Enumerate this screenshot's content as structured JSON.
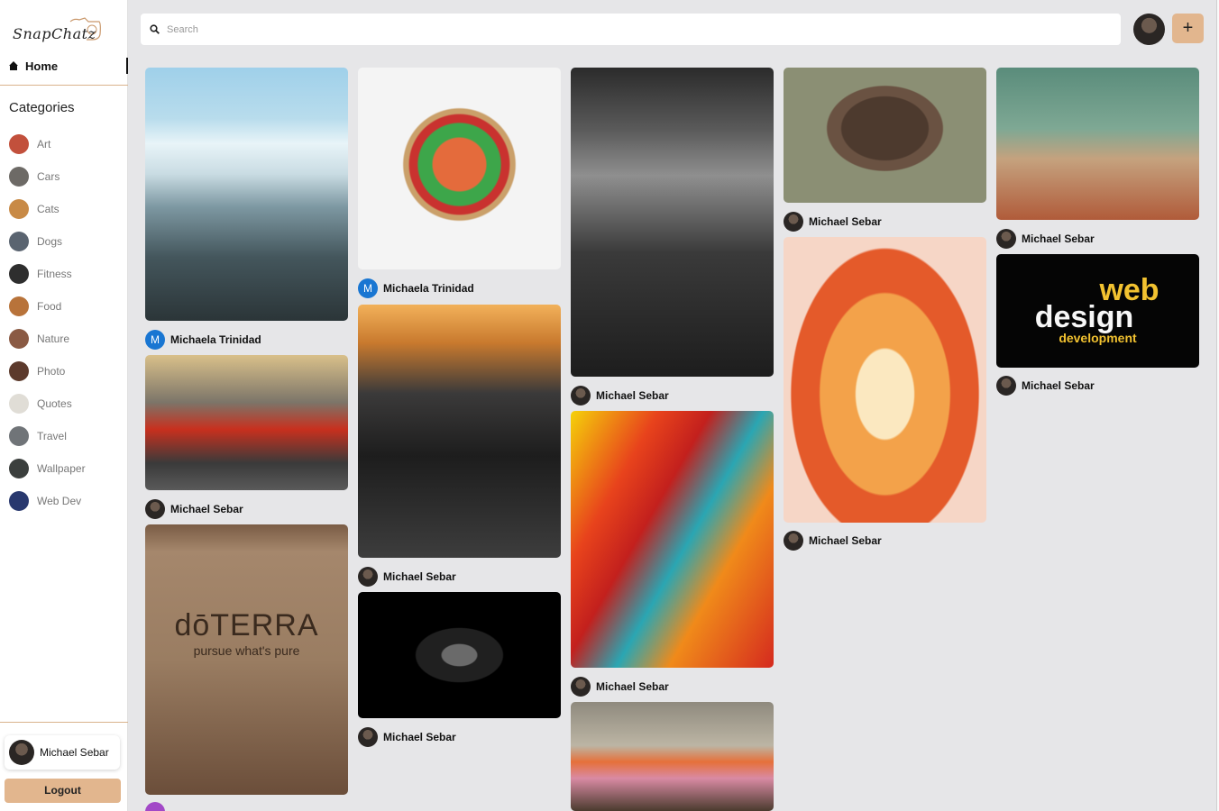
{
  "app": {
    "logo_text": "SnapChatz"
  },
  "nav": {
    "home_label": "Home"
  },
  "categories": {
    "title": "Categories",
    "items": [
      {
        "label": "Art",
        "color": "#c2503c"
      },
      {
        "label": "Cars",
        "color": "#6d6a66"
      },
      {
        "label": "Cats",
        "color": "#c88a46"
      },
      {
        "label": "Dogs",
        "color": "#5a6470"
      },
      {
        "label": "Fitness",
        "color": "#2e2e2e"
      },
      {
        "label": "Food",
        "color": "#b8733a"
      },
      {
        "label": "Nature",
        "color": "#8a5a44"
      },
      {
        "label": "Photo",
        "color": "#5c3a2c"
      },
      {
        "label": "Quotes",
        "color": "#e0ddd6"
      },
      {
        "label": "Travel",
        "color": "#707478"
      },
      {
        "label": "Wallpaper",
        "color": "#3b3f3d"
      },
      {
        "label": "Web Dev",
        "color": "#28386e"
      }
    ]
  },
  "user": {
    "name": "Michael Sebar",
    "logout_label": "Logout"
  },
  "search": {
    "placeholder": "Search",
    "value": ""
  },
  "add_button": {
    "label": "+"
  },
  "pins": [
    {
      "author": "Michaela Trinidad",
      "avatar_letter": "M"
    },
    {
      "author": "Michael Sebar"
    },
    {
      "author": ""
    },
    {
      "author": "Michaela Trinidad",
      "avatar_letter": "M"
    },
    {
      "author": "Michael Sebar"
    },
    {
      "author": "Michael Sebar"
    },
    {
      "author": "Michael Sebar"
    },
    {
      "author": "Michael Sebar"
    },
    {
      "author": ""
    },
    {
      "author": "Michael Sebar"
    },
    {
      "author": "Michael Sebar"
    },
    {
      "author": "Michael Sebar"
    },
    {
      "author": "Michael Sebar"
    }
  ],
  "image_text": {
    "doterra_brand": "dōTERRA",
    "doterra_tagline": "pursue what's pure",
    "webdesign_word1": "web",
    "webdesign_word2": "design",
    "webdesign_word3": "development"
  },
  "colors": {
    "accent": "#e2b68e",
    "background": "#e6e6e8",
    "avatar_letter_bg": "#1976d2"
  }
}
